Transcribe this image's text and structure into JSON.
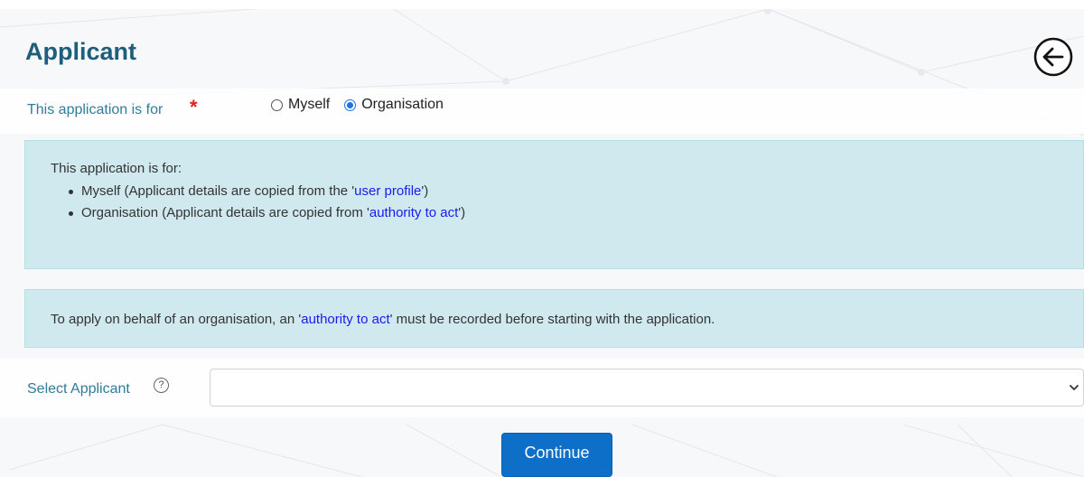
{
  "page": {
    "title": "Applicant"
  },
  "application_for": {
    "label": "This application is for",
    "required_marker": "*",
    "options": [
      {
        "label": "Myself",
        "checked": false
      },
      {
        "label": "Organisation",
        "checked": true
      }
    ]
  },
  "info_box_1": {
    "intro": "This application is for:",
    "item_1_prefix": "Myself (Applicant details are copied from the '",
    "item_1_link": "user profile",
    "item_1_suffix": "')",
    "item_2_prefix": "Organisation (Applicant details are copied from '",
    "item_2_link": "authority to act",
    "item_2_suffix": "')"
  },
  "info_box_2": {
    "prefix": "To apply on behalf of an organisation, an '",
    "link": "authority to act",
    "suffix": "' must be recorded before starting with the application."
  },
  "select_applicant": {
    "label": "Select Applicant",
    "help_glyph": "?",
    "value": ""
  },
  "actions": {
    "continue_label": "Continue"
  },
  "colors": {
    "title": "#1f5e7a",
    "label": "#2f7d9a",
    "info_bg": "#cfe9ef",
    "link": "#1a1aee",
    "primary_button": "#0d6fc7",
    "required": "#e02020"
  },
  "icons": {
    "back": "back-arrow-circle-icon",
    "help": "help-circle-icon",
    "dropdown": "chevron-down-icon"
  }
}
